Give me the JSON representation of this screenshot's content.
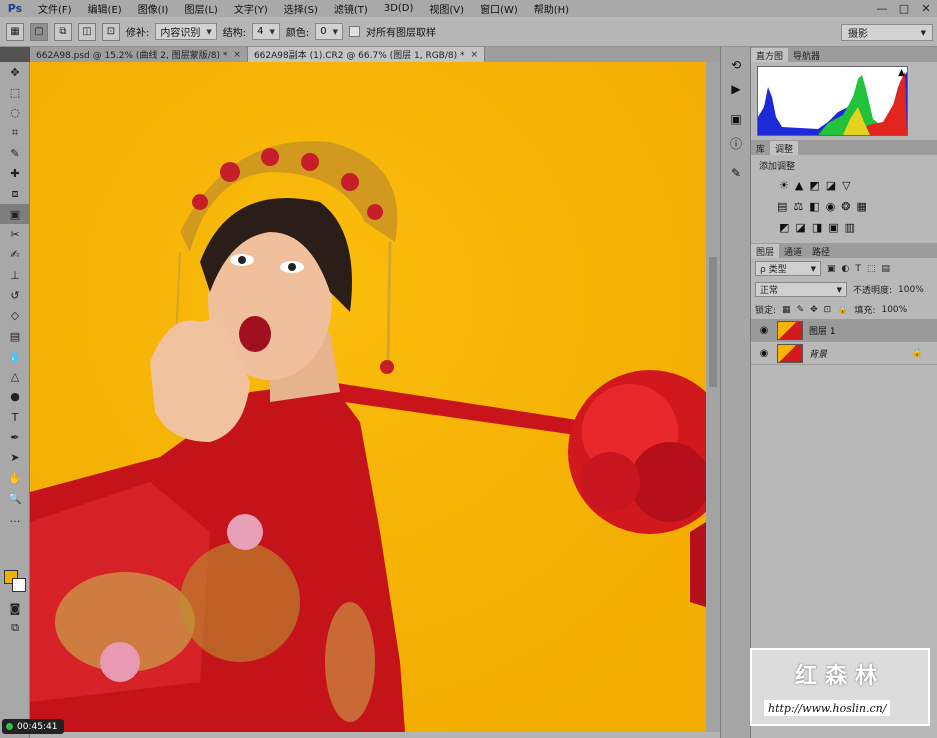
{
  "app": {
    "logo": "Ps"
  },
  "menu": [
    "文件(F)",
    "编辑(E)",
    "图像(I)",
    "图层(L)",
    "文字(Y)",
    "选择(S)",
    "滤镜(T)",
    "3D(D)",
    "视图(V)",
    "窗口(W)",
    "帮助(H)"
  ],
  "options": {
    "patch_label": "修补:",
    "patch_value": "内容识别",
    "structure_label": "结构:",
    "structure_value": "4",
    "color_label": "颜色:",
    "color_value": "0",
    "sample_all_label": "对所有图层取样",
    "workspace": "摄影"
  },
  "tabs": [
    {
      "label": "662A98.psd @ 15.2% (曲线 2, 图层蒙版/8) *",
      "close": "×"
    },
    {
      "label": "662A98副本 (1).CR2 @ 66.7% (图层 1, RGB/8) *",
      "close": "×"
    }
  ],
  "panels": {
    "histogram_tab": "直方图",
    "navigator_tab": "导航器",
    "library_tab": "库",
    "adjustments_tab": "调整",
    "adjustments_title": "添加调整",
    "layers_tab": "图层",
    "channels_tab": "通道",
    "paths_tab": "路径",
    "kind_label": "ρ 类型",
    "blend_mode": "正常",
    "opacity_label": "不透明度:",
    "opacity_value": "100%",
    "lock_label": "锁定:",
    "fill_label": "填充:",
    "fill_value": "100%"
  },
  "layers": [
    {
      "name": "图层 1",
      "selected": true
    },
    {
      "name": "背景",
      "selected": false
    }
  ],
  "status": {
    "timer": "00:45:41"
  },
  "watermark": {
    "title": "红森林",
    "url": "http://www.hoslin.cn/"
  }
}
